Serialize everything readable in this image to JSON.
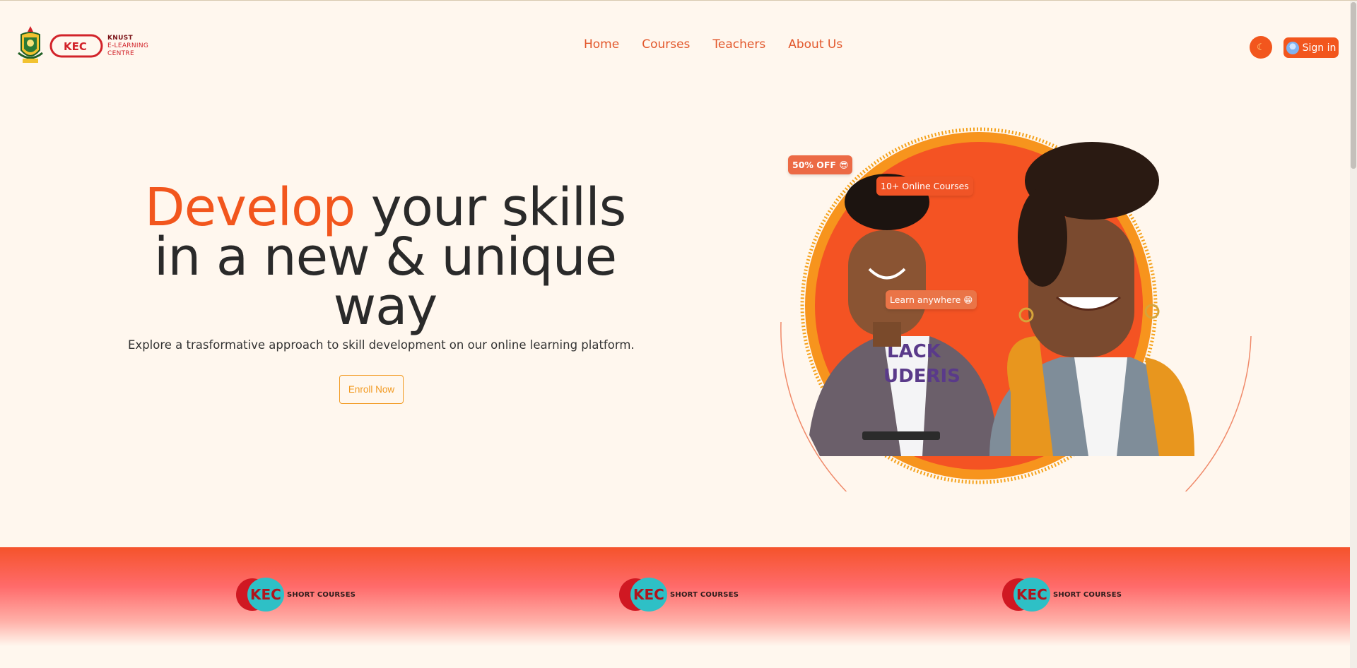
{
  "brand": {
    "logo_line1": "KNUST",
    "logo_line2": "E-LEARNING",
    "logo_line3": "CENTRE",
    "mark_text": "KEC"
  },
  "nav": {
    "items": [
      {
        "label": "Home"
      },
      {
        "label": "Courses"
      },
      {
        "label": "Teachers"
      },
      {
        "label": "About Us"
      }
    ]
  },
  "header_actions": {
    "theme_icon": "moon-icon",
    "signin_label": "Sign in"
  },
  "hero": {
    "title_accent": "Develop",
    "title_rest_line1": " your skills",
    "title_line2": "in a new & unique",
    "title_line3": "way",
    "subtitle": "Explore a trasformative approach to skill development on our online learning platform.",
    "cta_label": "Enroll Now"
  },
  "hero_badges": {
    "discount": "50% OFF 😎",
    "courses": "10+ Online Courses",
    "learn": "Learn anywhere 😁"
  },
  "banner": {
    "items": [
      {
        "mark": "KEC",
        "label": "SHORT COURSES"
      },
      {
        "mark": "KEC",
        "label": "SHORT COURSES"
      },
      {
        "mark": "KEC",
        "label": "SHORT COURSES"
      }
    ]
  },
  "colors": {
    "accent": "#f2561d",
    "cta": "#f29a21",
    "background": "#fff7ee",
    "text": "#2a2a2a"
  }
}
